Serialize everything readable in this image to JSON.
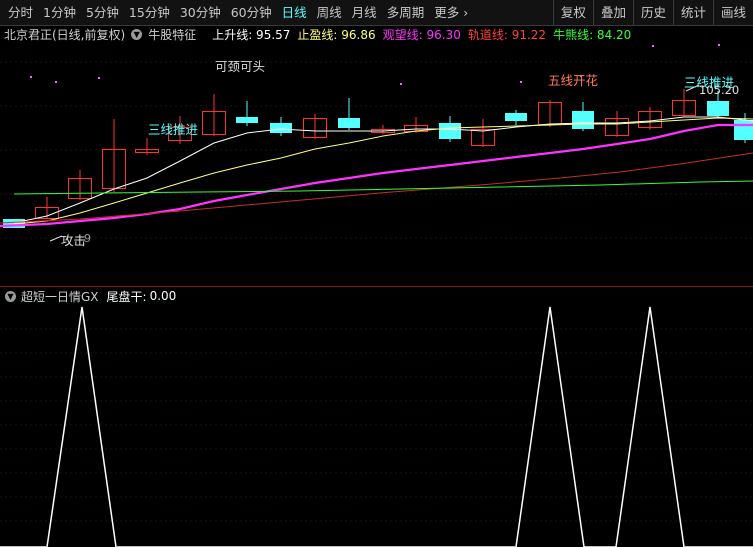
{
  "toolbar": {
    "periods": [
      "分时",
      "1分钟",
      "5分钟",
      "15分钟",
      "30分钟",
      "60分钟",
      "日线",
      "周线",
      "月线",
      "多周期"
    ],
    "active_period": "日线",
    "more_label": "更多",
    "more_icon": "chevron-right-icon",
    "right_buttons": [
      "复权",
      "叠加",
      "历史",
      "统计",
      "画线"
    ]
  },
  "main_info": {
    "title": "北京君正(日线,前复权)",
    "indicator_name": "牛股特征",
    "lines": [
      {
        "label": "上升线:",
        "value": "95.57",
        "color": "#ffffff"
      },
      {
        "label": "止盈线:",
        "value": "96.86",
        "color": "#ffff80"
      },
      {
        "label": "观望线:",
        "value": "96.30",
        "color": "#ff33ff"
      },
      {
        "label": "轨道线:",
        "value": "91.22",
        "color": "#ff4040"
      },
      {
        "label": "牛熊线:",
        "value": "84.20",
        "color": "#33ff33"
      }
    ]
  },
  "annotations": {
    "kejing": "可颈可头",
    "sanxian1": "三线推进",
    "wuxian": "五线开花",
    "sanxian2": "三线推进",
    "high_price": "105.20",
    "attack": "攻击",
    "low_digit": "9"
  },
  "sub_info": {
    "indicator_name": "超短一日情GX",
    "value_label": "尾盘干:",
    "value": "0.00"
  },
  "colors": {
    "up": "#ff3232",
    "down": "#54ffff",
    "grid": "#2a0e0e",
    "signal": "#ffffff"
  }
}
